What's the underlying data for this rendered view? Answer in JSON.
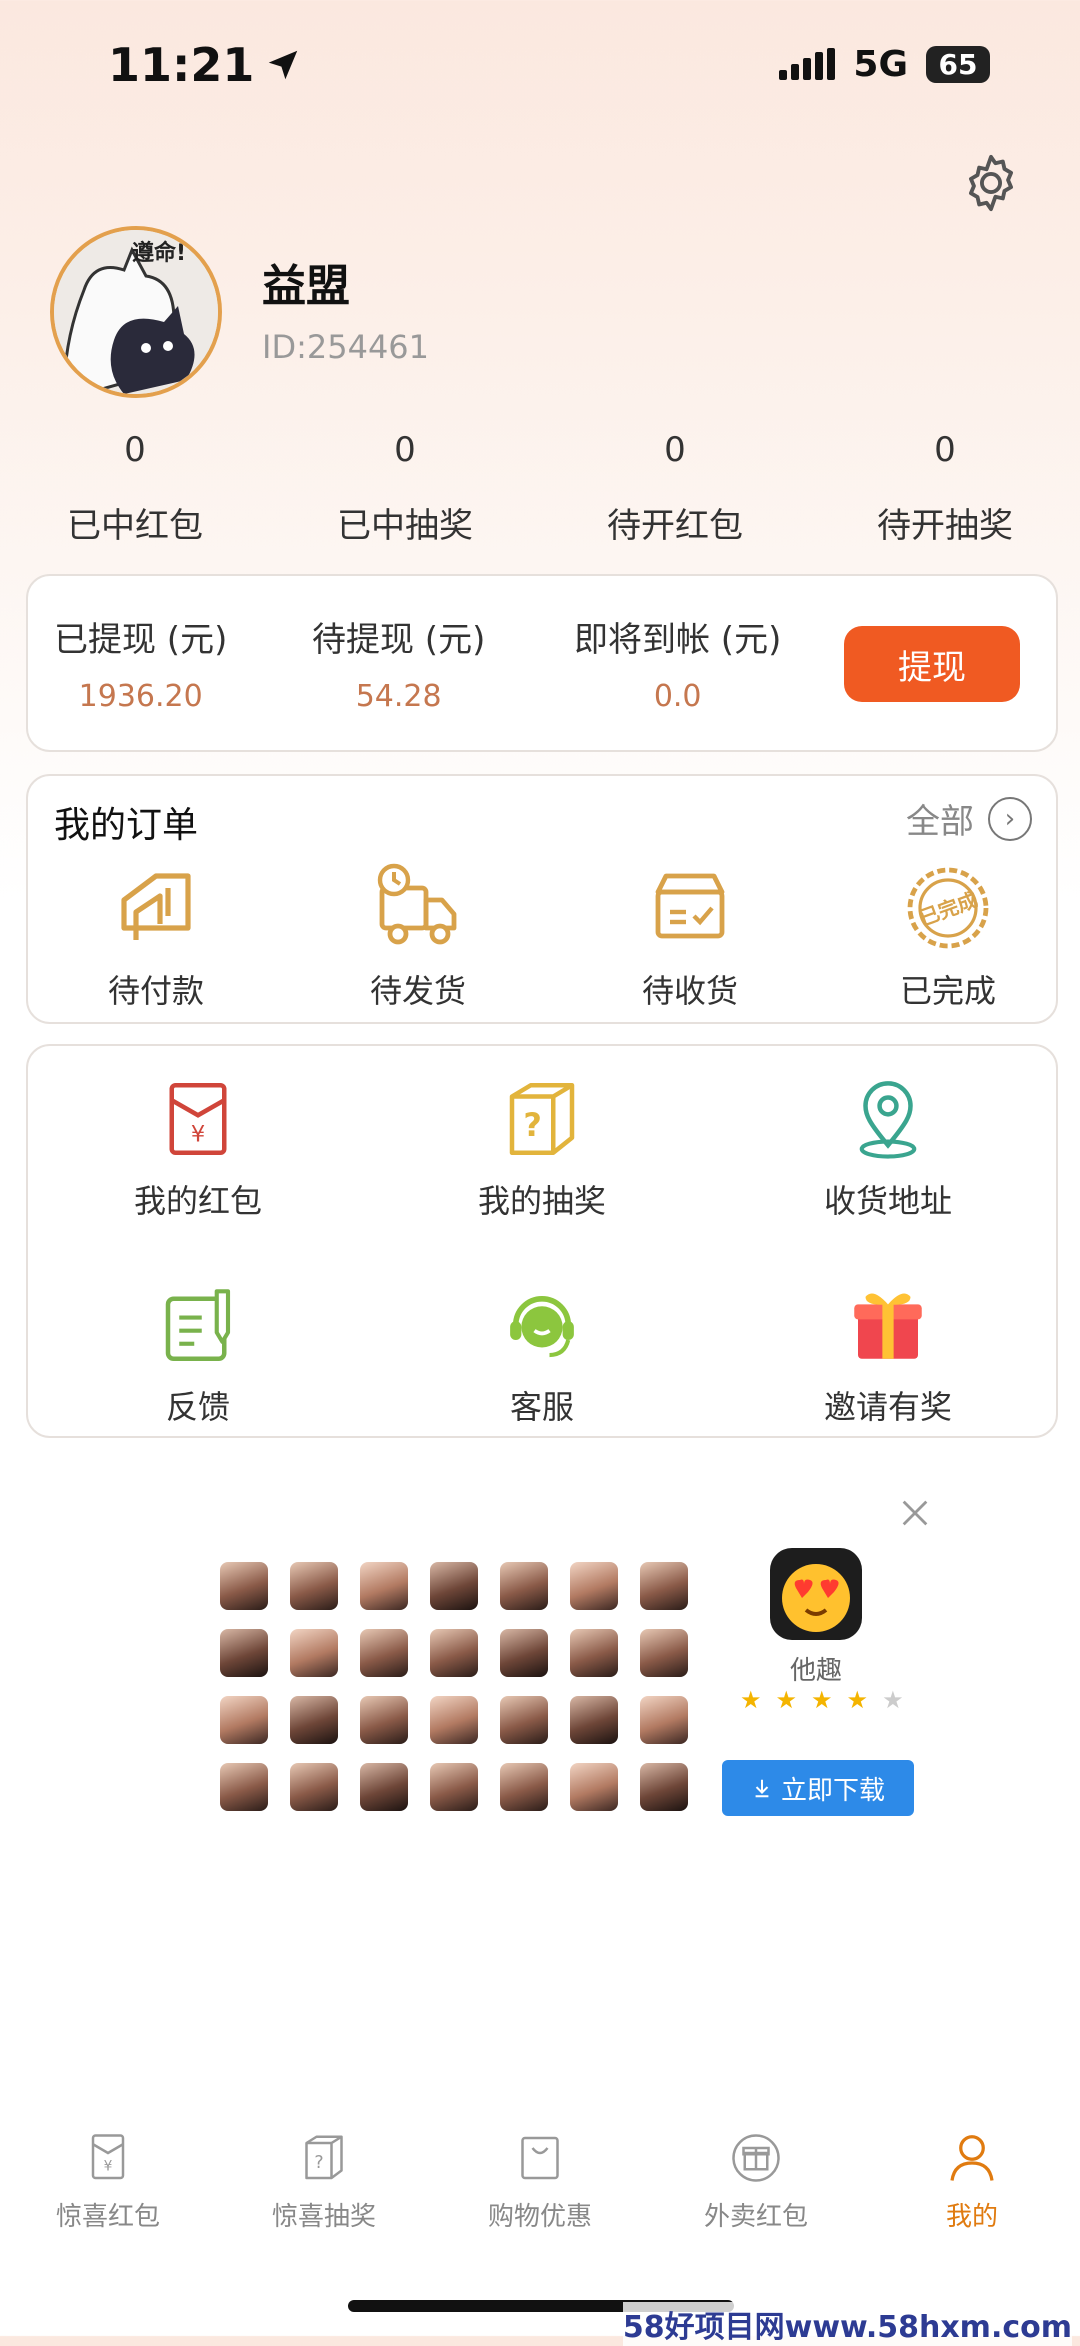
{
  "status_bar": {
    "time": "11:21",
    "network": "5G",
    "battery": "65"
  },
  "profile": {
    "name": "益盟",
    "id_text": "ID:254461",
    "avatar_text": "遵命!"
  },
  "stats": [
    {
      "value": "0",
      "label": "已中红包"
    },
    {
      "value": "0",
      "label": "已中抽奖"
    },
    {
      "value": "0",
      "label": "待开红包"
    },
    {
      "value": "0",
      "label": "待开抽奖"
    }
  ],
  "wallet": {
    "withdrawn_label": "已提现 (元)",
    "withdrawn_value": "1936.20",
    "pending_label": "待提现 (元)",
    "pending_value": "54.28",
    "arriving_label": "即将到帐 (元)",
    "arriving_value": "0.0",
    "withdraw_button": "提现"
  },
  "orders": {
    "title": "我的订单",
    "all_label": "全部",
    "items": [
      {
        "label": "待付款",
        "icon": "wallet-card-icon"
      },
      {
        "label": "待发货",
        "icon": "delivery-truck-icon"
      },
      {
        "label": "待收货",
        "icon": "receive-box-icon"
      },
      {
        "label": "已完成",
        "icon": "completed-stamp-icon",
        "stamp_text": "已完成"
      }
    ]
  },
  "services": [
    {
      "label": "我的红包",
      "icon": "red-envelope-icon"
    },
    {
      "label": "我的抽奖",
      "icon": "mystery-box-icon"
    },
    {
      "label": "收货地址",
      "icon": "location-pin-icon"
    },
    {
      "label": "反馈",
      "icon": "feedback-icon"
    },
    {
      "label": "客服",
      "icon": "customer-service-icon"
    },
    {
      "label": "邀请有奖",
      "icon": "gift-icon"
    }
  ],
  "ad": {
    "app_name": "他趣",
    "rating": 4,
    "download_label": "立即下载"
  },
  "tabbar": [
    {
      "label": "惊喜红包",
      "icon": "red-envelope-tab-icon",
      "active": false
    },
    {
      "label": "惊喜抽奖",
      "icon": "lottery-box-tab-icon",
      "active": false
    },
    {
      "label": "购物优惠",
      "icon": "shopping-bag-tab-icon",
      "active": false
    },
    {
      "label": "外卖红包",
      "icon": "gift-circle-tab-icon",
      "active": false
    },
    {
      "label": "我的",
      "icon": "person-tab-icon",
      "active": true
    }
  ],
  "watermark": "58好项目网www.58hxm.com",
  "colors": {
    "accent": "#f05a22",
    "money": "#c5774f",
    "active_tab": "#e07b10",
    "download": "#2d8ae8"
  }
}
